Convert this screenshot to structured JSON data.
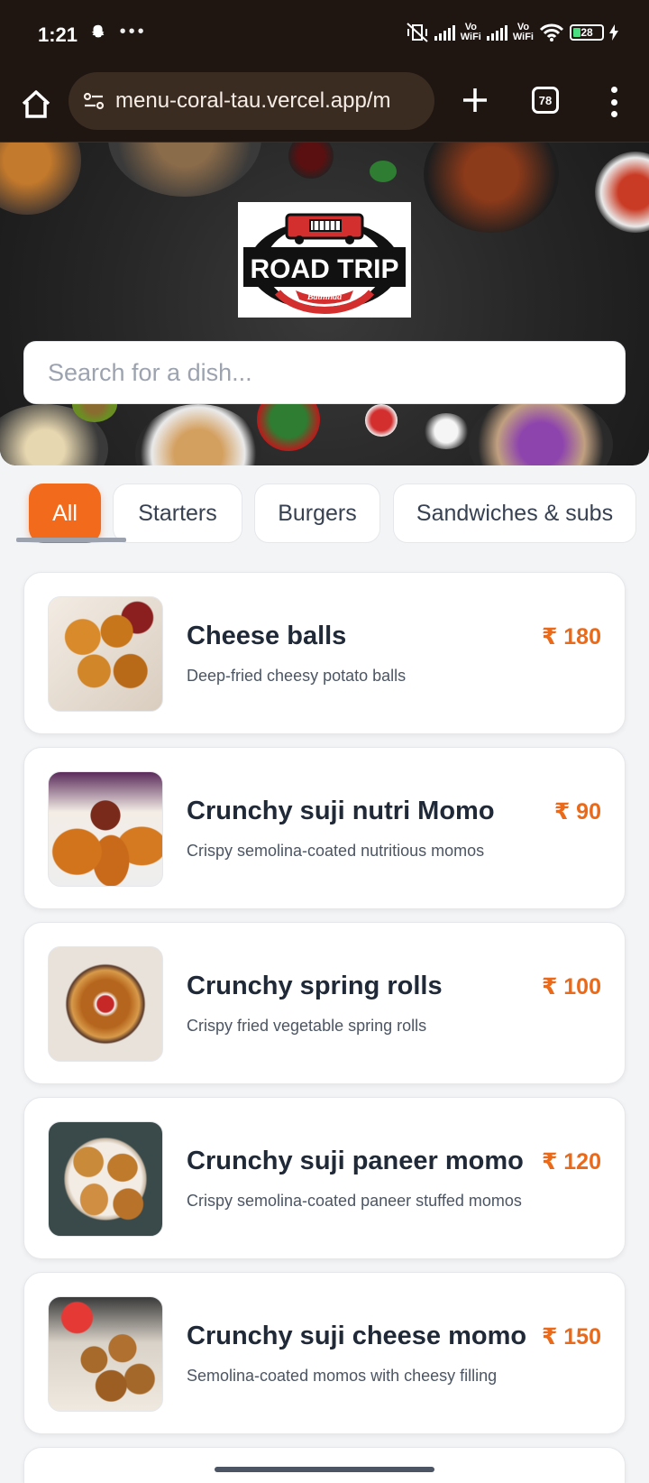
{
  "status_bar": {
    "time": "1:21",
    "left_icons": [
      "snapchat-icon",
      "more-dots-icon"
    ],
    "vowifi_label": "Vo\nWiFi",
    "battery": "28"
  },
  "browser": {
    "url": "menu-coral-tau.vercel.app/m",
    "tab_count": "78"
  },
  "hero": {
    "logo_text": "ROAD TRIP",
    "logo_subtext": "Bathinda",
    "search_placeholder": "Search for a dish..."
  },
  "categories": [
    {
      "label": "All",
      "active": true
    },
    {
      "label": "Starters",
      "active": false
    },
    {
      "label": "Burgers",
      "active": false
    },
    {
      "label": "Sandwiches & subs",
      "active": false
    }
  ],
  "menu_items": [
    {
      "name": "Cheese balls",
      "description": "Deep-fried cheesy potato balls",
      "price": "₹ 180"
    },
    {
      "name": "Crunchy suji nutri Momo",
      "description": "Crispy semolina-coated nutritious momos",
      "price": "₹ 90"
    },
    {
      "name": "Crunchy spring rolls",
      "description": "Crispy fried vegetable spring rolls",
      "price": "₹ 100"
    },
    {
      "name": "Crunchy suji paneer momo",
      "description": "Crispy semolina-coated paneer stuffed momos",
      "price": "₹ 120"
    },
    {
      "name": "Crunchy suji cheese momo",
      "description": "Semolina-coated momos with cheesy filling",
      "price": "₹ 150"
    }
  ],
  "colors": {
    "accent": "#f26b1d",
    "price": "#ea6a1a",
    "browser_bg": "#1f1612"
  }
}
